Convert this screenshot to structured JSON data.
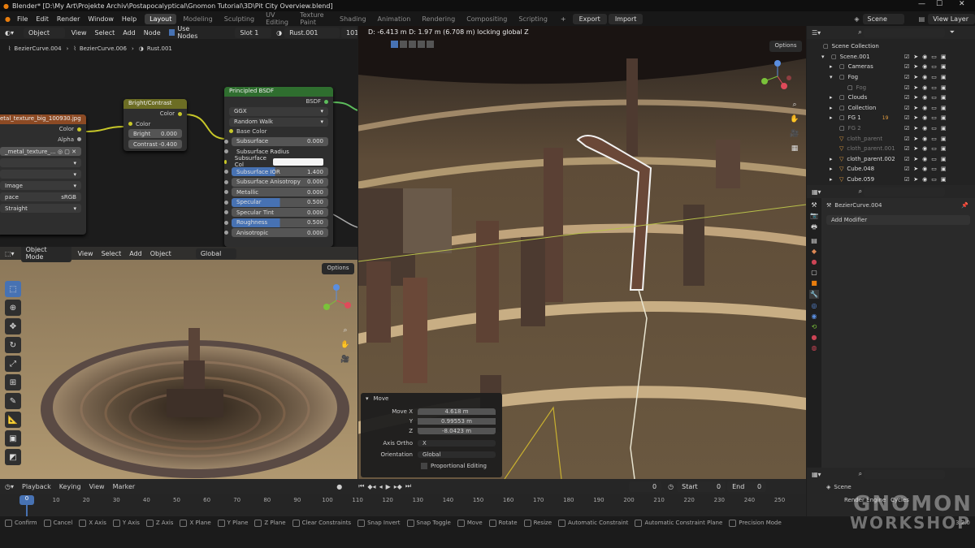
{
  "app": {
    "title": "Blender* [D:\\My Art\\Projekte Archiv\\Postapocalyptical\\Gnomon Tutorial\\3D\\Pit City Overview.blend]"
  },
  "menu": [
    "File",
    "Edit",
    "Render",
    "Window",
    "Help"
  ],
  "workspaces": [
    "Layout",
    "Modeling",
    "Sculpting",
    "UV Editing",
    "Texture Paint",
    "Shading",
    "Animation",
    "Rendering",
    "Compositing",
    "Scripting"
  ],
  "top_right": {
    "export": "Export",
    "import": "Import",
    "scene": "Scene",
    "view_layer": "View Layer"
  },
  "node_editor": {
    "object": "Object",
    "view": "View",
    "select": "Select",
    "add": "Add",
    "node": "Node",
    "use_nodes": "Use Nodes",
    "slot": "Slot 1",
    "material": "Rust.001",
    "users": "101",
    "breadcrumb": [
      "BezierCurve.004",
      "BezierCurve.006",
      "Rust.001"
    ],
    "image_node": {
      "title": "etal_texture_big_100930.jpg",
      "out_color": "Color",
      "out_alpha": "Alpha",
      "image_name": "_metal_texture_...",
      "row_image": "Image",
      "row_space_label": "pace",
      "row_space": "sRGB",
      "row_alpha": "Straight"
    },
    "bc_node": {
      "title": "Bright/Contrast",
      "out": "Color",
      "in": "Color",
      "bright_label": "Bright",
      "bright": "0.000",
      "contrast_label": "Contrast",
      "contrast": "-0.400"
    },
    "bsdf_node": {
      "title": "Principled BSDF",
      "out": "BSDF",
      "dist": "GGX",
      "ss_method": "Random Walk",
      "base_color": "Base Color",
      "rows": [
        {
          "label": "Subsurface",
          "value": "0.000",
          "fill": 0
        },
        {
          "label": "Subsurface Radius",
          "value": "",
          "fill": 0
        },
        {
          "label": "Subsurface Col",
          "value": "",
          "fill": 0
        },
        {
          "label": "Subsurface IOR",
          "value": "1.400",
          "fill": 0.45
        },
        {
          "label": "Subsurface Anisotropy",
          "value": "0.000",
          "fill": 0
        },
        {
          "label": "Metallic",
          "value": "0.000",
          "fill": 0
        },
        {
          "label": "Specular",
          "value": "0.500",
          "fill": 0.5
        },
        {
          "label": "Specular Tint",
          "value": "0.000",
          "fill": 0
        },
        {
          "label": "Roughness",
          "value": "0.500",
          "fill": 0.5
        },
        {
          "label": "Anisotropic",
          "value": "0.000",
          "fill": 0
        }
      ]
    }
  },
  "left_view": {
    "mode": "Object Mode",
    "view": "View",
    "select": "Select",
    "add": "Add",
    "object": "Object",
    "orientation": "Global",
    "options": "Options"
  },
  "main_view": {
    "status": "D: -6.413 m  D: 1.97 m (6.708 m) locking global Z",
    "options": "Options"
  },
  "move_panel": {
    "title": "Move",
    "x_label": "Move X",
    "x": "4.618 m",
    "y_label": "Y",
    "y": "0.99553 m",
    "z_label": "Z",
    "z": "-8.0423 m",
    "axis_ortho_label": "Axis Ortho",
    "axis_ortho": "X",
    "orientation_label": "Orientation",
    "orientation": "Global",
    "prop_edit": "Proportional Editing"
  },
  "outliner": {
    "items": [
      {
        "name": "Scene Collection",
        "indent": 0,
        "arrow": ""
      },
      {
        "name": "Scene.001",
        "indent": 1,
        "arrow": "▾"
      },
      {
        "name": "Cameras",
        "indent": 2,
        "arrow": "▸"
      },
      {
        "name": "Fog",
        "indent": 2,
        "arrow": "▾"
      },
      {
        "name": "Fog",
        "indent": 3,
        "arrow": ""
      },
      {
        "name": "Clouds",
        "indent": 2,
        "arrow": "▸"
      },
      {
        "name": "Collection",
        "indent": 2,
        "arrow": "▸"
      },
      {
        "name": "FG 1",
        "indent": 2,
        "arrow": "▸"
      },
      {
        "name": "FG 2",
        "indent": 2,
        "arrow": ""
      },
      {
        "name": "cloth_parent",
        "indent": 2,
        "arrow": ""
      },
      {
        "name": "cloth_parent.001",
        "indent": 2,
        "arrow": ""
      },
      {
        "name": "cloth_parent.002",
        "indent": 2,
        "arrow": "▸"
      },
      {
        "name": "Cube.048",
        "indent": 2,
        "arrow": "▸"
      },
      {
        "name": "Cube.059",
        "indent": 2,
        "arrow": "▸"
      }
    ],
    "fg1_count": "19"
  },
  "properties": {
    "object": "BezierCurve.004",
    "add_modifier": "Add Modifier"
  },
  "render_props": {
    "scene": "Scene",
    "engine_label": "Render Engine",
    "engine": "Cycles"
  },
  "timeline": {
    "playback": "Playback",
    "keying": "Keying",
    "view": "View",
    "marker": "Marker",
    "current": "0",
    "start_label": "Start",
    "start": "0",
    "end_label": "End",
    "end": "0",
    "ticks": [
      "0",
      "10",
      "20",
      "30",
      "40",
      "50",
      "60",
      "70",
      "80",
      "90",
      "100",
      "110",
      "120",
      "130",
      "140",
      "150",
      "160",
      "170",
      "180",
      "190",
      "200",
      "210",
      "220",
      "230",
      "240",
      "250"
    ]
  },
  "statusbar": [
    "Confirm",
    "Cancel",
    "X Axis",
    "Y Axis",
    "Z Axis",
    "X Plane",
    "Y Plane",
    "Z Plane",
    "Clear Constraints",
    "Snap Invert",
    "Snap Toggle",
    "Move",
    "Rotate",
    "Resize",
    "Automatic Constraint",
    "Automatic Constraint Plane",
    "Precision Mode"
  ],
  "version": "3.2.0",
  "watermark": {
    "line1": "GNOMON",
    "line2": "WORKSHOP"
  }
}
